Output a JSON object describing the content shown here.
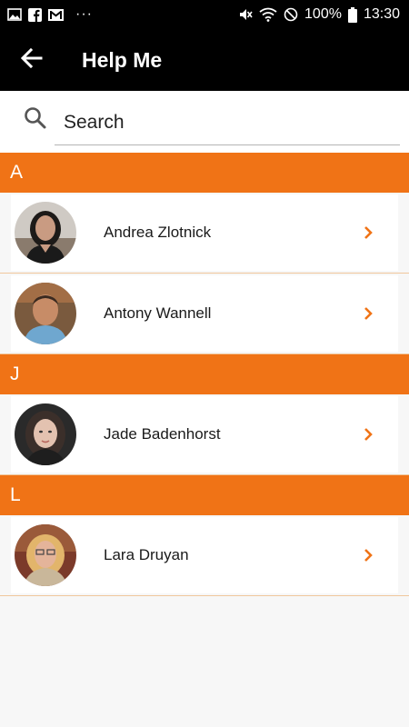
{
  "status_bar": {
    "battery_percent": "100%",
    "time": "13:30",
    "more_dots": "···",
    "left_icons": [
      "gallery-icon",
      "facebook-icon",
      "gmail-icon"
    ],
    "right_icons": [
      "mute-icon",
      "wifi-icon",
      "do-not-disturb-icon",
      "battery-icon"
    ]
  },
  "app_bar": {
    "title": "Help Me",
    "back_icon": "arrow-left-icon",
    "background": "#000000"
  },
  "search": {
    "placeholder": "Search",
    "value": ""
  },
  "colors": {
    "accent": "#f07316",
    "divider": "#f0c79c"
  },
  "sections": [
    {
      "letter": "A",
      "contacts": [
        {
          "name": "Andrea Zlotnick"
        },
        {
          "name": "Antony Wannell"
        }
      ]
    },
    {
      "letter": "J",
      "contacts": [
        {
          "name": "Jade Badenhorst"
        }
      ]
    },
    {
      "letter": "L",
      "contacts": [
        {
          "name": "Lara Druyan"
        }
      ]
    }
  ]
}
